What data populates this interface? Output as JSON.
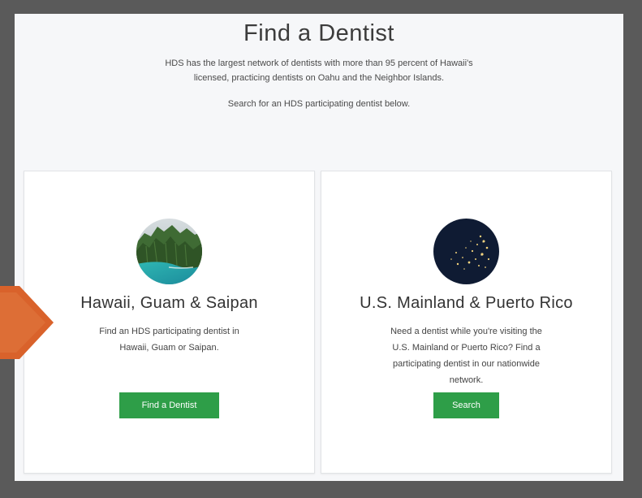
{
  "header": {
    "title": "Find a Dentist",
    "intro_line1": "HDS has the largest network of dentists with more than 95 percent of Hawaii's",
    "intro_line2": "licensed, practicing dentists on Oahu and the Neighbor Islands.",
    "search_note": "Search for an HDS participating dentist below."
  },
  "cards": [
    {
      "image": "hawaii-coast-photo",
      "title": "Hawaii, Guam & Saipan",
      "text_lines": [
        "Find an HDS participating dentist in",
        "Hawaii, Guam or Saipan."
      ],
      "button_label": "Find a Dentist"
    },
    {
      "image": "us-night-lights-photo",
      "title": "U.S. Mainland & Puerto Rico",
      "text_lines": [
        "Need a dentist while you're visiting the",
        "U.S. Mainland or Puerto Rico? Find a",
        "participating dentist in our nationwide",
        "network."
      ],
      "button_label": "Search"
    }
  ],
  "colors": {
    "button_green": "#2e9e48",
    "arrow_orange": "#d9622b",
    "frame_gray": "#5a5a5a"
  },
  "overlay": {
    "icon": "arrow-right-icon"
  }
}
